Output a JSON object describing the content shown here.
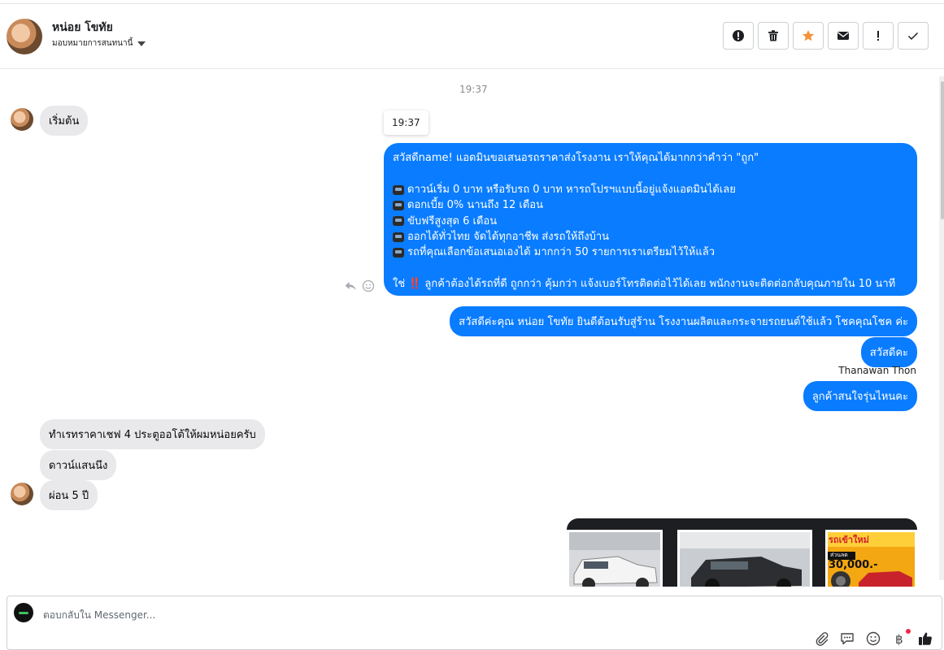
{
  "header": {
    "contact_name": "หน่อย โขทัย",
    "assign_label": "มอบหมายการสนทนานี้"
  },
  "toolbar": {
    "buttons": [
      {
        "name": "spam-button",
        "icon": "alert-circle-icon"
      },
      {
        "name": "delete-button",
        "icon": "trash-icon"
      },
      {
        "name": "star-button",
        "icon": "star-icon",
        "color": "#f7923b"
      },
      {
        "name": "mark-unread-button",
        "icon": "envelope-icon"
      },
      {
        "name": "follow-up-button",
        "icon": "exclamation-icon"
      },
      {
        "name": "mark-done-button",
        "icon": "check-icon"
      }
    ]
  },
  "thread": {
    "timestamp": "19:37",
    "tooltip_time": "19:37",
    "messages_in": {
      "start": "เริ่มต้น",
      "ask_price": "ทำเรทราคาเชฟ 4 ประตูออโต้ให้ผมหน่อยครับ",
      "down": "ดาวน์แสนนึง",
      "installment": "ผ่อน 5 ปี"
    },
    "offer": {
      "greeting": "สวัสดีname! แอดมินขอเสนอรถราคาส่งโรงงาน เราให้คุณได้มากกว่าคำว่า \"ถูก\"",
      "items": [
        "ดาวน์เริ่ม 0 บาท หรือรับรถ 0 บาท หารถโปรฯแบบนี้อยู่แจ้งแอดมินได้เลย",
        "ดอกเบี้ย 0% นานถึง 12 เดือน",
        "ขับฟรีสูงสุด 6 เดือน",
        "ออกได้ทั่วไทย จัดได้ทุกอาชีพ ส่งรถให้ถึงบ้าน",
        "รถที่คุณเลือกข้อเสนอเองได้ มากกว่า 50 รายการเราเตรียมไว้ให้แล้ว"
      ],
      "closing_prefix": "ใช่",
      "closing_mark": "‼️",
      "closing_text": "ลูกค้าต้องได้รถที่ดี ถูกกว่า คุ้มกว่า แจ้งเบอร์โทรติดต่อไว้ได้เลย พนักงานจะติดต่อกลับคุณภายใน 10 นาที"
    },
    "messages_out": {
      "welcome": "สวัสดีค่ะคุณ หน่อย โขทัย ยินดีต้อนรับสู่ร้าน โรงงานผลิตและกระจายรถยนต์ใช้แล้ว โชคคุณโชค ค่ะ",
      "hello": "สวัสดีคะ",
      "which_model": "ลูกค้าสนใจรุ่นไหนคะ"
    },
    "sender_name": "Thanawan Thon",
    "carousel_promo": {
      "title": "รถเข้าใหม่",
      "subtitle": "ส่วนลด",
      "amount": "30,000.-"
    }
  },
  "composer": {
    "placeholder": "ตอบกลับใน Messenger...",
    "icons": [
      "paperclip-icon",
      "saved-reply-icon",
      "emoji-icon",
      "baht-icon",
      "like-icon"
    ]
  },
  "colors": {
    "outgoing": "#0a7cff",
    "incoming": "#e9e9eb",
    "accent_star": "#f7923b"
  }
}
